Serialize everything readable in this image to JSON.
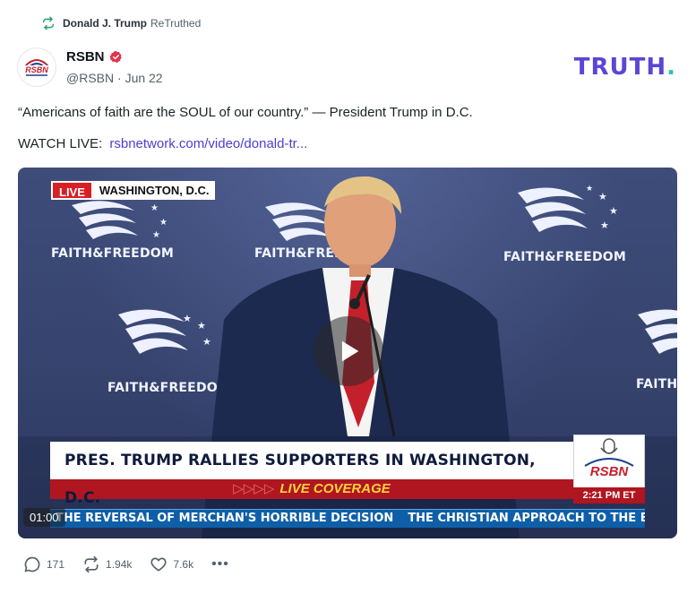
{
  "retruth": {
    "user": "Donald J. Trump",
    "action": "ReTruthed"
  },
  "author": {
    "name": "RSBN",
    "handle": "@RSBN",
    "date": "Jun 22",
    "meta_sep": " · ",
    "verified_icon": "verified-badge-icon"
  },
  "brand": {
    "logo": "TRUTH",
    "dot": "."
  },
  "post": {
    "text": "“Americans of faith are the SOUL of our country.” — President Trump in D.C.",
    "watch_label": "WATCH LIVE:",
    "link_text": "rsbnetwork.com/video/donald-tr..."
  },
  "video": {
    "live_label": "LIVE",
    "location": "WASHINGTON, D.C.",
    "backdrop_logo": "FAITH&FREEDOM",
    "headline": "PRES. TRUMP RALLIES SUPPORTERS IN WASHINGTON, D.C.",
    "coverage": "LIVE COVERAGE",
    "coverage_arrows": "▷▷▷▷",
    "network_logo": "RSBN",
    "time": "2:21 PM ET",
    "ticker_1": "THE REVERSAL OF MERCHAN'S HORRIBLE DECISION",
    "ticker_2": "THE CHRISTIAN APPROACH TO THE BALLOT",
    "timecode": "01:00",
    "play_icon": "play-icon"
  },
  "actions": {
    "replies": "171",
    "retruths": "1.94k",
    "likes": "7.6k",
    "more": "•••"
  },
  "colors": {
    "brand": "#5a46d6",
    "link": "#4a3fd1",
    "retruth_icon": "#22a06b"
  }
}
